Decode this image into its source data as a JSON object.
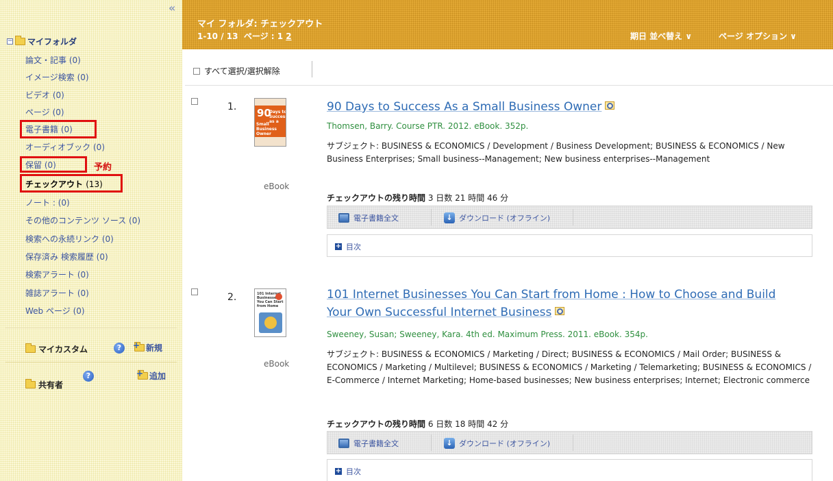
{
  "sidebar": {
    "collapse_glyph": "«",
    "folder_title": "マイフォルダ",
    "items": [
      {
        "label": "論文・記事",
        "count": "(0)"
      },
      {
        "label": "イメージ検索",
        "count": "(0)"
      },
      {
        "label": "ビデオ",
        "count": "(0)"
      },
      {
        "label": "ページ",
        "count": "(0)"
      },
      {
        "label": "電子書籍",
        "count": "(0)"
      },
      {
        "label": "オーディオブック",
        "count": "(0)"
      },
      {
        "label": "保留",
        "count": "(0)"
      },
      {
        "label": "チェックアウト",
        "count": "(13)"
      },
      {
        "label": "ノート :",
        "count": "(0)"
      },
      {
        "label": "その他のコンテンツ ソース",
        "count": "(0)"
      },
      {
        "label": "検索への永続リンク",
        "count": "(0)"
      },
      {
        "label": "保存済み 検索履歴",
        "count": "(0)"
      },
      {
        "label": "検索アラート",
        "count": "(0)"
      },
      {
        "label": "雑誌アラート",
        "count": "(0)"
      },
      {
        "label": "Web ページ",
        "count": "(0)"
      }
    ],
    "reserve_note": "予約",
    "custom_label": "マイカスタム",
    "custom_action": "新規",
    "shared_label": "共有者",
    "shared_action": "追加"
  },
  "header": {
    "title": "マイ フォルダ: チェックアウト",
    "range": "1-10 / 13",
    "page_label": "ページ : 1",
    "page_next": "2",
    "sort_label": "期日 並べ替え ∨",
    "options_label": "ページ オプション ∨"
  },
  "select_all_label": "すべて選択/選択解除",
  "results": [
    {
      "number": "1.",
      "title": "90 Days to Success As a Small Business Owner",
      "meta": "Thomsen, Barry. Course PTR. 2012. eBook. 352p.",
      "subject_label": "サブジェクト:",
      "subjects": "BUSINESS & ECONOMICS / Development / Business Development; BUSINESS & ECONOMICS / New Business Enterprises; Small business--Management; New business enterprises--Management",
      "time_label": "チェックアウトの残り時間",
      "time_value": "3 日数 21 時間 46 分",
      "format": "eBook",
      "cover_big": "90",
      "cover_small": "Days to Success as a",
      "cover_band": "Small Business Owner",
      "fulltext_label": "電子書籍全文",
      "download_label": "ダウンロード (オフライン)",
      "toc_label": "目次"
    },
    {
      "number": "2.",
      "title_line1": "101 Internet Businesses You Can Start from Home : How to Choose and Build",
      "title_line2": "Your Own Successful Internet Business",
      "meta": "Sweeney, Susan; Sweeney, Kara. 4th ed. Maximum Press. 2011. eBook. 354p.",
      "subject_label": "サブジェクト:",
      "subjects": "BUSINESS & ECONOMICS / Marketing / Direct; BUSINESS & ECONOMICS / Mail Order; BUSINESS & ECONOMICS / Marketing / Multilevel; BUSINESS & ECONOMICS / Marketing / Telemarketing; BUSINESS & ECONOMICS / E-Commerce / Internet Marketing; Home-based businesses; New business enterprises; Internet; Electronic commerce",
      "time_label": "チェックアウトの残り時間",
      "time_value": "6 日数 18 時間 42 分",
      "format": "eBook",
      "cover_text": "101 Internet Businesses You Can Start from Home",
      "fulltext_label": "電子書籍全文",
      "download_label": "ダウンロード (オフライン)",
      "toc_label": "目次"
    }
  ],
  "colors": {
    "header_bg": "#e3a935",
    "sidebar_bg": "#fbf8d8",
    "link": "#2f6cb5",
    "meta_green": "#2f8f3f",
    "highlight_red": "#e01010"
  }
}
